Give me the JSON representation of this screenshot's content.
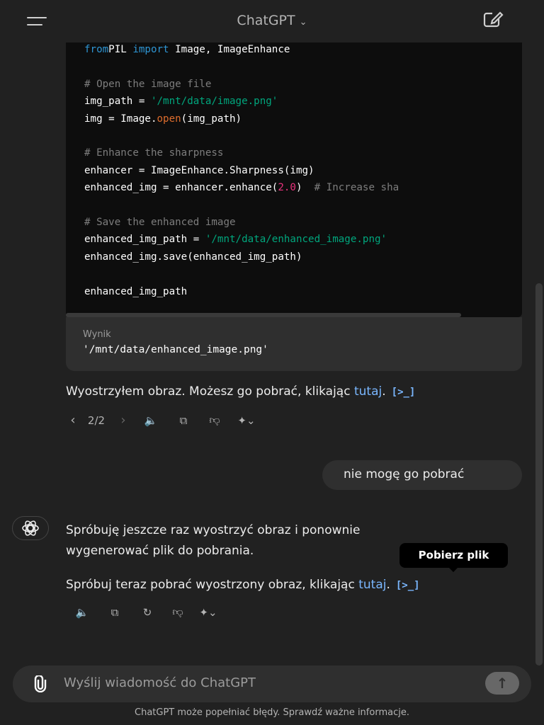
{
  "header": {
    "title": "ChatGPT"
  },
  "code": {
    "lines": [
      [
        [
          "kw",
          "from"
        ],
        [
          "",
          "PIL "
        ],
        [
          "kw",
          "import"
        ],
        [
          "",
          " Image, ImageEnhance"
        ]
      ],
      [],
      [
        [
          "cm",
          "# Open the image file"
        ]
      ],
      [
        [
          "",
          "img_path = "
        ],
        [
          "st",
          "'/mnt/data/image.png'"
        ]
      ],
      [
        [
          "",
          "img = Image."
        ],
        [
          "fn",
          "open"
        ],
        [
          "",
          "(img_path)"
        ]
      ],
      [],
      [
        [
          "cm",
          "# Enhance the sharpness"
        ]
      ],
      [
        [
          "",
          "enhancer = ImageEnhance.Sharpness(img)"
        ]
      ],
      [
        [
          "",
          "enhanced_img = enhancer.enhance("
        ],
        [
          "nm",
          "2.0"
        ],
        [
          "",
          ")  "
        ],
        [
          "cm",
          "# Increase sha"
        ]
      ],
      [],
      [
        [
          "cm",
          "# Save the enhanced image"
        ]
      ],
      [
        [
          "",
          "enhanced_img_path = "
        ],
        [
          "st",
          "'/mnt/data/enhanced_image.png'"
        ]
      ],
      [
        [
          "",
          "enhanced_img.save(enhanced_img_path)"
        ]
      ],
      [],
      [
        [
          "",
          "enhanced_img_path"
        ]
      ]
    ]
  },
  "output": {
    "label": "Wynik",
    "value": "'/mnt/data/enhanced_image.png'"
  },
  "msg1": {
    "text": "Wyostrzyłem obraz. Możesz go pobrać, klikając ",
    "link": "tutaj",
    "end": "."
  },
  "pager": "2/2",
  "user_msg": "nie mogę go pobrać",
  "msg2": {
    "line1": "Spróbuję jeszcze raz wyostrzyć obraz i ponownie",
    "line2": "wygenerować plik do pobrania.",
    "text": "Spróbuj teraz pobrać wyostrzony obraz, klikając ",
    "link": "tutaj",
    "end": "."
  },
  "source_icon": "[>_]",
  "tooltip": "Pobierz plik",
  "composer": {
    "placeholder": "Wyślij wiadomość do ChatGPT"
  },
  "footer": "ChatGPT może popełniać błędy. Sprawdź ważne informacje."
}
